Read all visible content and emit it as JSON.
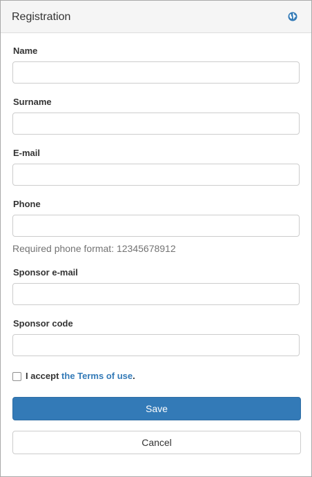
{
  "header": {
    "title": "Registration",
    "icon": "globe-icon"
  },
  "form": {
    "fields": [
      {
        "label": "Name",
        "value": "",
        "placeholder": ""
      },
      {
        "label": "Surname",
        "value": "",
        "placeholder": ""
      },
      {
        "label": "E-mail",
        "value": "",
        "placeholder": ""
      },
      {
        "label": "Phone",
        "value": "",
        "placeholder": ""
      },
      {
        "label": "Sponsor e-mail",
        "value": "",
        "placeholder": ""
      },
      {
        "label": "Sponsor code",
        "value": "",
        "placeholder": ""
      }
    ],
    "phone_help": "Required phone format: 12345678912",
    "terms": {
      "checked": false,
      "prefix": "I accept",
      "link_text": "the Terms of use",
      "suffix": "."
    }
  },
  "actions": {
    "save_label": "Save",
    "cancel_label": "Cancel"
  },
  "colors": {
    "primary": "#337ab7",
    "link": "#337ab7",
    "heading_bg": "#f5f5f5"
  }
}
